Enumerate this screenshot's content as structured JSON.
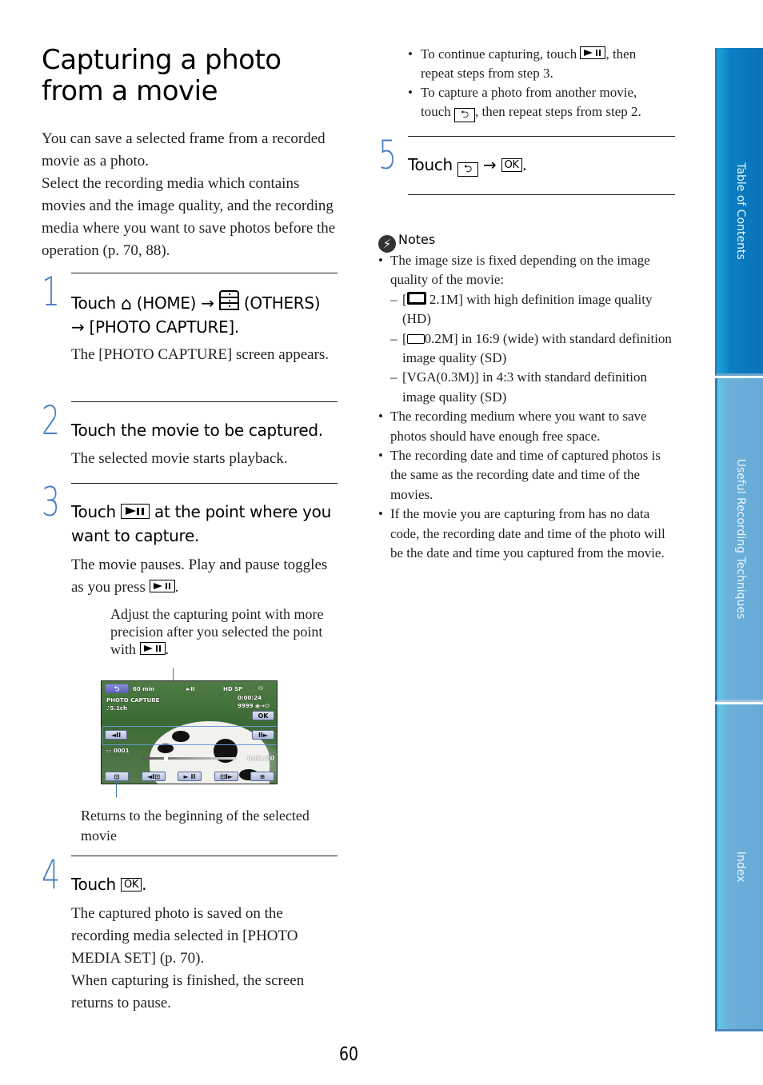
{
  "page": {
    "title_line1": "Capturing a photo",
    "title_line2": "from a movie",
    "intro": "You can save a selected frame from a recorded movie as a photo.",
    "intro2": "Select the recording media which contains movies and the image quality, and the recording media where you want to save photos before the operation (p. 70, 88).",
    "page_number": "60"
  },
  "icons": {
    "home": "home-icon",
    "others": "others-icon",
    "play_pause": "play-pause-icon",
    "return": "return-icon",
    "ok": "OK",
    "notes": "notes-icon",
    "arrow": "→"
  },
  "steps": [
    {
      "number": "1",
      "head_a": "Touch",
      "home_label": "(HOME)",
      "others_label": "(OTHERS)",
      "head_b": "[PHOTO CAPTURE].",
      "body": "The [PHOTO CAPTURE] screen appears."
    },
    {
      "number": "2",
      "head": "Touch the movie to be captured.",
      "body": "The selected movie starts playback."
    },
    {
      "number": "3",
      "head_a": "Touch",
      "head_b": "at the point where you want to capture.",
      "body_a": "The movie pauses. Play and pause toggles as you press",
      "body_b": ".",
      "callout_a": "Adjust the capturing point with more precision after you selected the point with",
      "callout_b": ".",
      "callout_bottom": "Returns to the beginning of the selected movie"
    },
    {
      "number": "4",
      "head_a": "Touch",
      "head_b": ".",
      "body1": "The captured photo is saved on the recording media selected in [PHOTO MEDIA SET] (p. 70).",
      "body2": "When capturing is finished, the screen returns to pause."
    },
    {
      "number": "5",
      "head_a": "Touch",
      "head_b": "."
    }
  ],
  "continue_bullets": [
    {
      "a": "To continue capturing, touch",
      "b": ", then repeat steps from step 3."
    },
    {
      "a": "To capture a photo from another movie, touch",
      "b": ", then repeat steps from step 2."
    }
  ],
  "camera_screen": {
    "return_btn": "⮌",
    "battery": "60 min",
    "play_state": "►II",
    "quality": "HD SP",
    "mode": "PHOTO CAPTURE",
    "audio": "♪5.1ch",
    "time_top": "0:00:24",
    "photo_count": "9999",
    "ok_btn": "OK",
    "frame_back_btn": "◄II",
    "frame_fwd_btn": "II►",
    "file_number": "0001",
    "time_bottom": "0:01:20",
    "progress_fraction": 0.25,
    "btn_start": "⊡",
    "btn_prev": "◄I⊡",
    "btn_playpause": "► II",
    "btn_next": "⊡I►",
    "btn_menu": "≡"
  },
  "notes": {
    "heading": "Notes",
    "items": [
      {
        "text": "The image size is fixed depending on the image quality of the movie:",
        "sub": [
          {
            "text": "2.1M] with high definition image quality (HD)",
            "icon": "wide-thick"
          },
          {
            "text": "0.2M] in 16:9 (wide) with standard definition image quality (SD)",
            "icon": "wide-thin"
          },
          {
            "text": "[VGA(0.3M)] in 4:3 with standard definition image quality (SD)"
          }
        ]
      },
      {
        "text": "The recording medium where you want to save photos should have enough free space."
      },
      {
        "text": "The recording date and time of captured photos is the same as the recording date and time of the movies."
      },
      {
        "text": "If the movie you are capturing from has no data code, the recording date and time of the photo will be the date and time you captured from the movie."
      }
    ]
  },
  "side_tabs": [
    {
      "label": "Table of Contents",
      "color": "#0a7fc2"
    },
    {
      "label": "Useful Recording Techniques",
      "color": "#66a9d6"
    },
    {
      "label": "Index",
      "color": "#66a9d6"
    }
  ]
}
